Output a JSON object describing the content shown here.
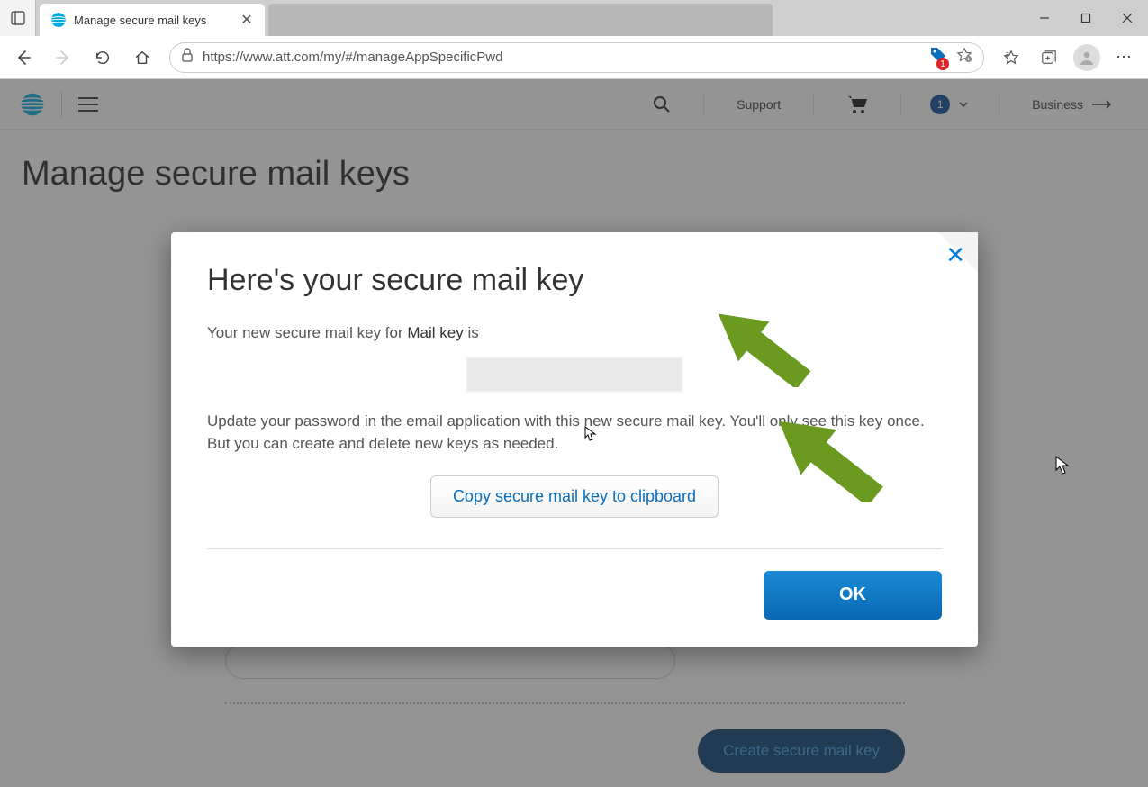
{
  "browser": {
    "tab_title": "Manage secure mail keys",
    "url_display": "https://www.att.com/my/#/manageAppSpecificPwd",
    "shopping_badge_count": "1",
    "window_controls": {
      "minimize": "—",
      "maximize": "▢",
      "close": "✕"
    }
  },
  "site_header": {
    "support_label": "Support",
    "account_badge": "1",
    "business_label": "Business"
  },
  "page": {
    "title": "Manage secure mail keys",
    "create_button": "Create secure mail key"
  },
  "modal": {
    "title": "Here's your secure mail key",
    "intro_prefix": "Your new secure mail key for ",
    "intro_bold": "Mail key",
    "intro_suffix": " is",
    "instructions": "Update your password in the email application with this new secure mail key. You'll only see this key once. But you can create and delete new keys as needed.",
    "copy_button": "Copy secure mail key to clipboard",
    "ok_button": "OK"
  }
}
